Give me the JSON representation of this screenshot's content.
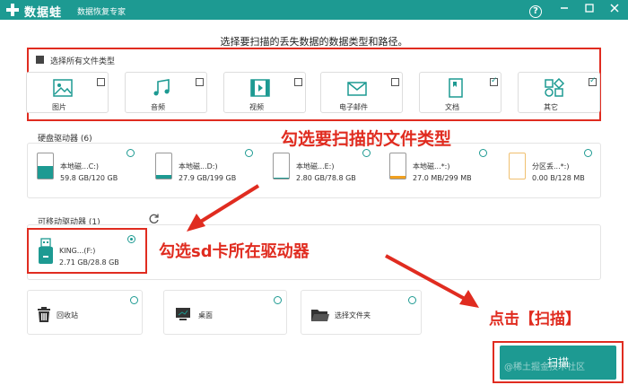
{
  "app": {
    "name": "数据蛙",
    "subtitle": "数据恢复专家",
    "help_icon": "help-icon",
    "controls": [
      "minimize-icon",
      "maximize-icon",
      "close-icon"
    ]
  },
  "headline": "选择要扫描的丢失数据的数据类型和路径。",
  "file_types": {
    "select_all_label": "选择所有文件类型",
    "items": [
      {
        "label": "图片",
        "icon": "image-icon",
        "checked": false
      },
      {
        "label": "音频",
        "icon": "music-icon",
        "checked": false
      },
      {
        "label": "视频",
        "icon": "video-icon",
        "checked": false
      },
      {
        "label": "电子邮件",
        "icon": "mail-icon",
        "checked": false
      },
      {
        "label": "文档",
        "icon": "document-icon",
        "checked": true
      },
      {
        "label": "其它",
        "icon": "other-icon",
        "checked": true
      }
    ]
  },
  "hard_drives": {
    "label": "硬盘驱动器 (6)",
    "drives": [
      {
        "name": "本地磁...C:)",
        "size": "59.8 GB/120 GB",
        "color": "#1d9a92"
      },
      {
        "name": "本地磁...D:)",
        "size": "27.9 GB/199 GB",
        "color": "#1d9a92"
      },
      {
        "name": "本地磁...E:)",
        "size": "2.80 GB/78.8 GB",
        "color": "#1d9a92"
      },
      {
        "name": "本地磁...*:)",
        "size": "27.0 MB/299 MB",
        "color": "#f0a020"
      },
      {
        "name": "分区丢...*:)",
        "size": "0.00   B/128 MB",
        "color": "#f0a020"
      }
    ]
  },
  "removable": {
    "label": "可移动驱动器 (1)",
    "refresh_icon": "refresh-icon",
    "drive": {
      "name": "KING...(F:)",
      "size": "2.71 GB/28.8 GB",
      "icon": "usb-drive-icon"
    }
  },
  "locations": [
    {
      "label": "回收站",
      "icon": "recycle-bin-icon"
    },
    {
      "label": "桌面",
      "icon": "desktop-icon"
    },
    {
      "label": "选择文件夹",
      "icon": "folder-icon"
    }
  ],
  "annotations": {
    "file_types": "勾选要扫描的文件类型",
    "sd_card": "勾选sd卡所在驱动器",
    "scan": "点击【扫描】"
  },
  "scan_button": "扫描",
  "watermark": "@稀土掘金技术社区",
  "colors": {
    "accent": "#1d9a92",
    "annotation": "#e02c20"
  }
}
